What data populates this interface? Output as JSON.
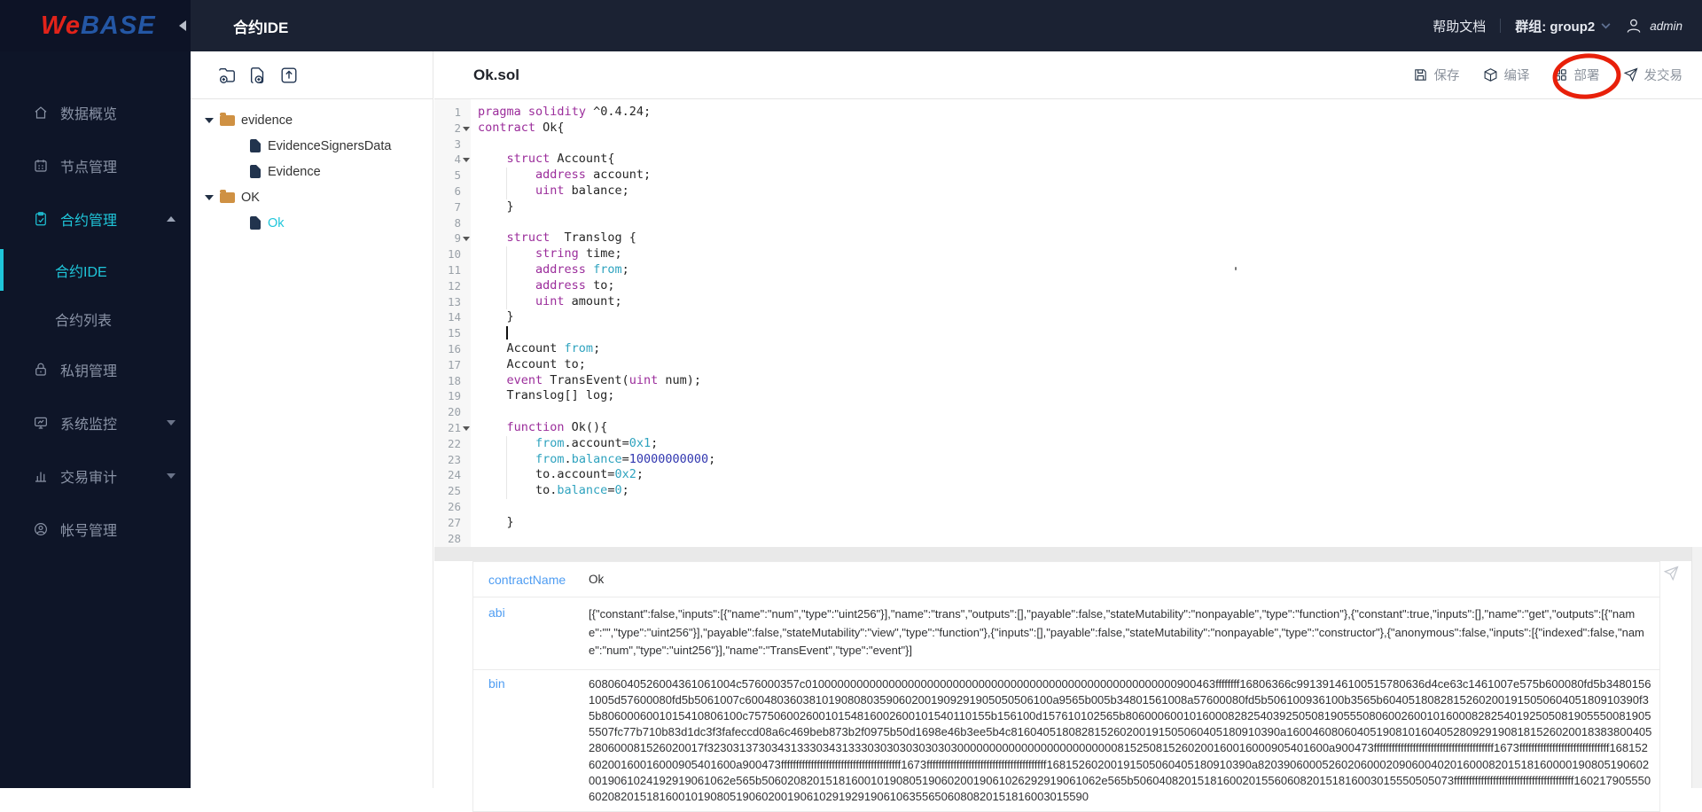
{
  "colors": {
    "accent": "#1fc6da",
    "annotation_red": "#e8200a",
    "label_blue": "#4f9df2",
    "folder_orange": "#cf9143"
  },
  "brand": {
    "we": "We",
    "base": "BASE"
  },
  "topbar": {
    "title": "合约IDE",
    "help": "帮助文档",
    "group_label": "群组: group2",
    "user": "admin"
  },
  "sidebar": {
    "items": [
      {
        "label": "数据概览",
        "icon": "home",
        "active": false
      },
      {
        "label": "节点管理",
        "icon": "node",
        "active": false
      },
      {
        "label": "合约管理",
        "icon": "contract",
        "active": true,
        "caret": "up",
        "children": [
          {
            "label": "合约IDE",
            "active": true
          },
          {
            "label": "合约列表",
            "active": false
          }
        ]
      },
      {
        "label": "私钥管理",
        "icon": "lock",
        "active": false
      },
      {
        "label": "系统监控",
        "icon": "monitor",
        "active": false,
        "caret": "down"
      },
      {
        "label": "交易审计",
        "icon": "audit",
        "active": false,
        "caret": "down"
      },
      {
        "label": "帐号管理",
        "icon": "account",
        "active": false
      }
    ]
  },
  "tree": {
    "toolbar": [
      {
        "id": "new-folder",
        "icon": "folder-plus"
      },
      {
        "id": "new-file",
        "icon": "file-plus"
      },
      {
        "id": "upload",
        "icon": "upload"
      }
    ],
    "nodes": [
      {
        "type": "folder",
        "label": "evidence",
        "expanded": true,
        "children": [
          {
            "type": "file",
            "label": "EvidenceSignersData"
          },
          {
            "type": "file",
            "label": "Evidence"
          }
        ]
      },
      {
        "type": "folder",
        "label": "OK",
        "expanded": true,
        "children": [
          {
            "type": "file",
            "label": "Ok",
            "selected": true
          }
        ]
      }
    ]
  },
  "editor": {
    "filename": "Ok.sol",
    "actions": [
      {
        "id": "save",
        "label": "保存",
        "icon": "save"
      },
      {
        "id": "compile",
        "label": "编译",
        "icon": "compile"
      },
      {
        "id": "deploy",
        "label": "部署",
        "icon": "deploy",
        "annotated": true
      },
      {
        "id": "send-transaction",
        "label": "发交易",
        "icon": "send"
      }
    ],
    "lines": [
      {
        "n": 1,
        "parts": [
          [
            "tk",
            "pragma"
          ],
          [
            "tp",
            " "
          ],
          [
            "tk",
            "solidity"
          ],
          [
            "tp",
            " ^0.4.24;"
          ]
        ]
      },
      {
        "n": 2,
        "fold": true,
        "parts": [
          [
            "tk",
            "contract"
          ],
          [
            "tp",
            " Ok{"
          ]
        ]
      },
      {
        "n": 3,
        "parts": []
      },
      {
        "n": 4,
        "fold": true,
        "parts": [
          [
            "tp",
            "    "
          ],
          [
            "tk",
            "struct"
          ],
          [
            "tp",
            " Account{"
          ]
        ]
      },
      {
        "n": 5,
        "guide": true,
        "parts": [
          [
            "tp",
            "        "
          ],
          [
            "tk",
            "address"
          ],
          [
            "tp",
            " account;"
          ]
        ]
      },
      {
        "n": 6,
        "guide": true,
        "parts": [
          [
            "tp",
            "        "
          ],
          [
            "tk",
            "uint"
          ],
          [
            "tp",
            " balance;"
          ]
        ]
      },
      {
        "n": 7,
        "parts": [
          [
            "tp",
            "    }"
          ]
        ]
      },
      {
        "n": 8,
        "parts": []
      },
      {
        "n": 9,
        "fold": true,
        "parts": [
          [
            "tp",
            "    "
          ],
          [
            "tk",
            "struct"
          ],
          [
            "tp",
            "  Translog {"
          ]
        ]
      },
      {
        "n": 10,
        "guide": true,
        "parts": [
          [
            "tp",
            "        "
          ],
          [
            "tk",
            "string"
          ],
          [
            "tp",
            " time;"
          ]
        ]
      },
      {
        "n": 11,
        "guide": true,
        "parts": [
          [
            "tp",
            "        "
          ],
          [
            "tk",
            "address"
          ],
          [
            "tp",
            " "
          ],
          [
            "tv",
            "from"
          ],
          [
            "tp",
            ";"
          ]
        ]
      },
      {
        "n": 12,
        "guide": true,
        "parts": [
          [
            "tp",
            "        "
          ],
          [
            "tk",
            "address"
          ],
          [
            "tp",
            " to;"
          ]
        ]
      },
      {
        "n": 13,
        "guide": true,
        "parts": [
          [
            "tp",
            "        "
          ],
          [
            "tk",
            "uint"
          ],
          [
            "tp",
            " amount;"
          ]
        ]
      },
      {
        "n": 14,
        "parts": [
          [
            "tp",
            "    }"
          ]
        ]
      },
      {
        "n": 15,
        "cursor": true,
        "parts": [
          [
            "tp",
            "    "
          ]
        ]
      },
      {
        "n": 16,
        "parts": [
          [
            "tp",
            "    Account "
          ],
          [
            "tv",
            "from"
          ],
          [
            "tp",
            ";"
          ]
        ]
      },
      {
        "n": 17,
        "parts": [
          [
            "tp",
            "    Account to;"
          ]
        ]
      },
      {
        "n": 18,
        "parts": [
          [
            "tp",
            "    "
          ],
          [
            "tk",
            "event"
          ],
          [
            "tp",
            " TransEvent("
          ],
          [
            "tk",
            "uint"
          ],
          [
            "tp",
            " num);"
          ]
        ]
      },
      {
        "n": 19,
        "parts": [
          [
            "tp",
            "    Translog[] log;"
          ]
        ]
      },
      {
        "n": 20,
        "parts": []
      },
      {
        "n": 21,
        "fold": true,
        "parts": [
          [
            "tp",
            "    "
          ],
          [
            "tk",
            "function"
          ],
          [
            "tp",
            " Ok(){"
          ]
        ]
      },
      {
        "n": 22,
        "guide": true,
        "parts": [
          [
            "tp",
            "        "
          ],
          [
            "tv",
            "from"
          ],
          [
            "tp",
            ".account="
          ],
          [
            "ta",
            "0x1"
          ],
          [
            "tp",
            ";"
          ]
        ]
      },
      {
        "n": 23,
        "guide": true,
        "parts": [
          [
            "tp",
            "        "
          ],
          [
            "tv",
            "from"
          ],
          [
            "tp",
            "."
          ],
          [
            "tv",
            "balance"
          ],
          [
            "tp",
            "="
          ],
          [
            "tn",
            "10000000000"
          ],
          [
            "tp",
            ";"
          ]
        ]
      },
      {
        "n": 24,
        "guide": true,
        "parts": [
          [
            "tp",
            "        to.account="
          ],
          [
            "ta",
            "0x2"
          ],
          [
            "tp",
            ";"
          ]
        ]
      },
      {
        "n": 25,
        "guide": true,
        "parts": [
          [
            "tp",
            "        to."
          ],
          [
            "tv",
            "balance"
          ],
          [
            "tp",
            "="
          ],
          [
            "ta",
            "0"
          ],
          [
            "tp",
            ";"
          ]
        ]
      },
      {
        "n": 26,
        "parts": []
      },
      {
        "n": 27,
        "parts": [
          [
            "tp",
            "    }"
          ]
        ]
      },
      {
        "n": 28,
        "parts": []
      }
    ]
  },
  "output": {
    "rows": [
      {
        "key": "contractName",
        "value": "Ok"
      },
      {
        "key": "abi",
        "value": "[{\"constant\":false,\"inputs\":[{\"name\":\"num\",\"type\":\"uint256\"}],\"name\":\"trans\",\"outputs\":[],\"payable\":false,\"stateMutability\":\"nonpayable\",\"type\":\"function\"},{\"constant\":true,\"inputs\":[],\"name\":\"get\",\"outputs\":[{\"name\":\"\",\"type\":\"uint256\"}],\"payable\":false,\"stateMutability\":\"view\",\"type\":\"function\"},{\"inputs\":[],\"payable\":false,\"stateMutability\":\"nonpayable\",\"type\":\"constructor\"},{\"anonymous\":false,\"inputs\":[{\"indexed\":false,\"name\":\"num\",\"type\":\"uint256\"}],\"name\":\"TransEvent\",\"type\":\"event\"}]"
      },
      {
        "key": "bin",
        "value": "60806040526004361061004c576000357c0100000000000000000000000000000000000000000000000000000000900463ffffffff16806366c99139146100515780636d4ce63c1461007e575b600080fd5b34801561005d57600080fd5b5061007c600480360381019080803590602001909291905050506100a9565b005b34801561008a57600080fd5b506100936100b3565b6040518082815260200191505060405180910390f35b8060006001015410806100c75750600260010154816002600101540110155b156100d157610102565b80600060010160008282540392505081905550806002600101600082825401925050819055500819055507fc77b710b83d1dc3f3fafeccd08a6c469beb873b2f0975b50d1698e46b3ee5b4c816040518082815260200191505060405180910390a160046080604051908101604052809291908181526020018383800405280600081526020017f3230313730343133303431333030303030303030000000000000000000000000815250815260200160016000905401600a900473ffffffffffffffffffffffffffffffffffffffff1673ffffffffffffffffffffffffffffff16815260200160016000905401600a900473ffffffffffffffffffffffffffffffffffffffff1673ffffffffffffffffffffffffffffffffffffffff16815260200191505060405180910390a82039060005260206000209060040201600082015181600001908051906020019061024192919061062e565b50602082015181600101908051906020019061026292919061062e565b50604082015181600201556060820151816003015550505073ffffffffffffffffffffffffffffffffffffffff160217905550602082015181600101908051906020019061029192919061063556506080820151816003015590"
      }
    ]
  }
}
